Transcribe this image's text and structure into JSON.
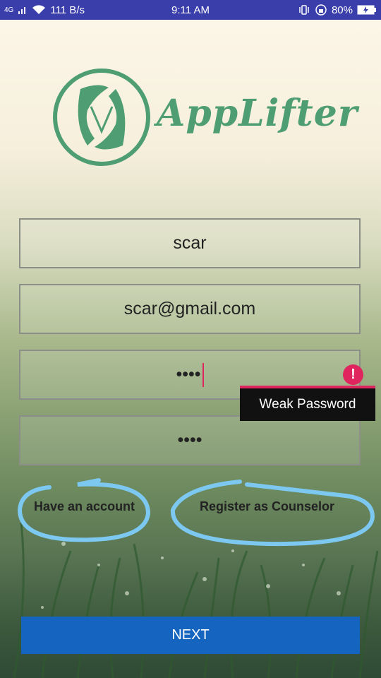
{
  "status_bar": {
    "network": "4G",
    "speed": "111 B/s",
    "time": "9:11 AM",
    "battery": "80%",
    "icons": [
      "signal-icon",
      "wifi-icon",
      "vibrate-icon",
      "rotation-lock-icon",
      "battery-icon"
    ]
  },
  "brand": {
    "name": "AppLifter",
    "color": "#4f9e73"
  },
  "form": {
    "name_value": "scar",
    "email_value": "scar@gmail.com",
    "password_value": "••••",
    "confirm_password_value": "••••"
  },
  "error": {
    "message": "Weak Password",
    "icon": "!"
  },
  "links": {
    "have_account": "Have an account",
    "register_counselor": "Register as Counselor"
  },
  "next_button": "NEXT",
  "colors": {
    "status_bar": "#3a3eab",
    "accent": "#1565c0",
    "error": "#e0245e",
    "scribble": "#7cc8f0"
  }
}
